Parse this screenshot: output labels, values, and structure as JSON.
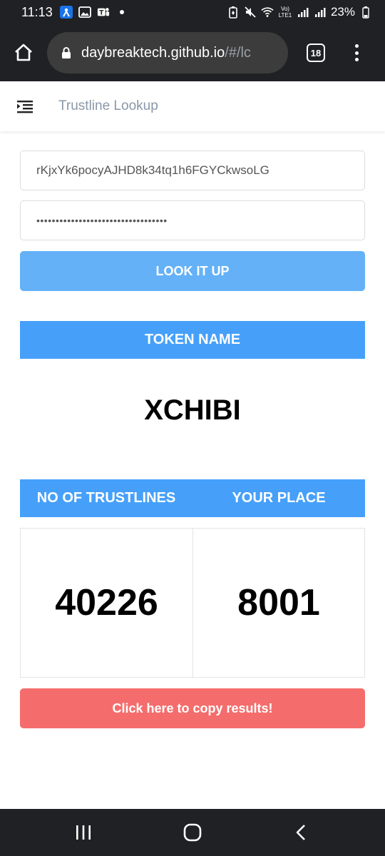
{
  "status_bar": {
    "time": "11:13",
    "network_label": "Vo) LTE1",
    "battery": "23%"
  },
  "browser": {
    "url_main": "daybreaktech.github.io",
    "url_rest": "/#/lc",
    "tab_count": "18"
  },
  "app": {
    "title": "Trustline Lookup"
  },
  "form": {
    "address_value": "rKjxYk6pocyAJHD8k34tq1h6FGYCkwsoLG",
    "secret_value": "••••••••••••••••••••••••••••••••••",
    "lookup_label": "LOOK IT UP"
  },
  "token": {
    "header": "TOKEN NAME",
    "value": "XCHIBI"
  },
  "results": {
    "header_trustlines": "NO OF TRUSTLINES",
    "header_place": "YOUR PLACE",
    "trustlines_value": "40226",
    "place_value": "8001"
  },
  "copy": {
    "label": "Click here to copy results!"
  },
  "colors": {
    "primary_header": "#46a0fa",
    "lookup_button": "#64b1f8",
    "copy_button": "#f46d6c",
    "system_bar": "#202124"
  },
  "icons": {
    "home": "home-icon",
    "lock": "lock-icon",
    "tabs": "tabs-icon",
    "menu": "more-vert-icon",
    "sidebar_toggle": "menu-toggle-icon",
    "nav_recents": "recents-icon",
    "nav_home": "nav-home-icon",
    "nav_back": "back-icon"
  }
}
